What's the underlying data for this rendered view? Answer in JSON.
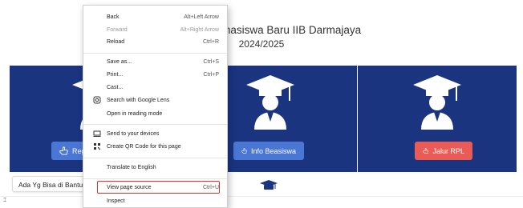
{
  "page": {
    "title": "PMB Mahasiswa Baru IIB Darmajaya",
    "title_visible": "n Mahasiswa Baru IIB Darmajaya",
    "subtitle": "2024/2025"
  },
  "cards": [
    {
      "button_label": "Reg",
      "button_color": "#4a76d4"
    },
    {
      "button_label": "Info Beasiswa",
      "button_color": "#4a76d4"
    },
    {
      "button_label": "Jalur RPL",
      "button_color": "#ea5b55"
    }
  ],
  "colors": {
    "card_bg": "#1b3480",
    "highlight": "#d9342b"
  },
  "help_box": {
    "label": "Ada Yg Bisa di Bantu?"
  },
  "context_menu": {
    "items": [
      {
        "label": "Back",
        "shortcut": "Alt+Left Arrow"
      },
      {
        "label": "Forward",
        "shortcut": "Alt+Right Arrow"
      },
      {
        "label": "Reload",
        "shortcut": "Ctrl+R"
      },
      {
        "label": "Save as...",
        "shortcut": "Ctrl+S"
      },
      {
        "label": "Print...",
        "shortcut": "Ctrl+P"
      },
      {
        "label": "Cast...",
        "shortcut": ""
      },
      {
        "label": "Search with Google Lens",
        "shortcut": "",
        "icon": "lens-icon"
      },
      {
        "label": "Open in reading mode",
        "shortcut": ""
      },
      {
        "label": "Send to your devices",
        "shortcut": "",
        "icon": "devices-icon"
      },
      {
        "label": "Create QR Code for this page",
        "shortcut": "",
        "icon": "qr-code-icon"
      },
      {
        "label": "Translate to English",
        "shortcut": ""
      },
      {
        "label": "View page source",
        "shortcut": "Ctrl+U"
      },
      {
        "label": "Inspect",
        "shortcut": ""
      }
    ]
  }
}
